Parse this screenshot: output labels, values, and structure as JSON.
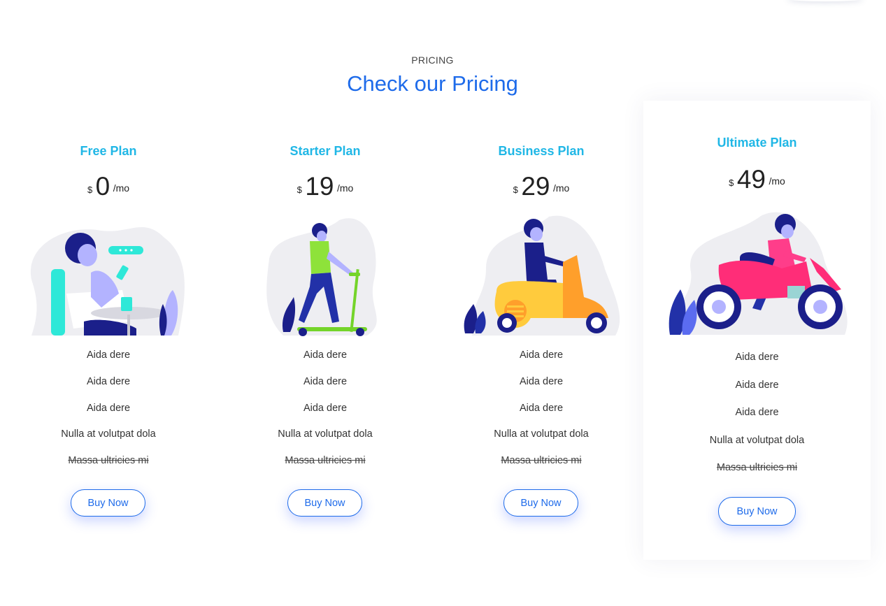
{
  "section": {
    "eyebrow": "PRICING",
    "title": "Check our Pricing"
  },
  "colors": {
    "accent": "#1e6bea",
    "plan_name": "#20b7e6"
  },
  "plans": [
    {
      "name": "Free Plan",
      "currency": "$",
      "amount": "0",
      "period": "/mo",
      "illustration": "person-at-cafe-table-with-phone-illustration",
      "features": [
        "Aida dere",
        "Aida dere",
        "Aida dere",
        "Nulla at volutpat dola",
        "Massa ultricies mi"
      ],
      "unavailable_features": [
        "Massa ultricies mi"
      ],
      "button": "Buy Now"
    },
    {
      "name": "Starter Plan",
      "currency": "$",
      "amount": "19",
      "period": "/mo",
      "illustration": "person-on-kick-scooter-illustration",
      "features": [
        "Aida dere",
        "Aida dere",
        "Aida dere",
        "Nulla at volutpat dola",
        "Massa ultricies mi"
      ],
      "unavailable_features": [
        "Massa ultricies mi"
      ],
      "button": "Buy Now"
    },
    {
      "name": "Business Plan",
      "currency": "$",
      "amount": "29",
      "period": "/mo",
      "illustration": "person-on-motor-scooter-illustration",
      "features": [
        "Aida dere",
        "Aida dere",
        "Aida dere",
        "Nulla at volutpat dola",
        "Massa ultricies mi"
      ],
      "unavailable_features": [
        "Massa ultricies mi"
      ],
      "button": "Buy Now"
    },
    {
      "name": "Ultimate Plan",
      "currency": "$",
      "amount": "49",
      "period": "/mo",
      "illustration": "person-on-motorcycle-illustration",
      "featured": true,
      "features": [
        "Aida dere",
        "Aida dere",
        "Aida dere",
        "Nulla at volutpat dola",
        "Massa ultricies mi"
      ],
      "unavailable_features": [
        "Massa ultricies mi"
      ],
      "button": "Buy Now"
    }
  ]
}
